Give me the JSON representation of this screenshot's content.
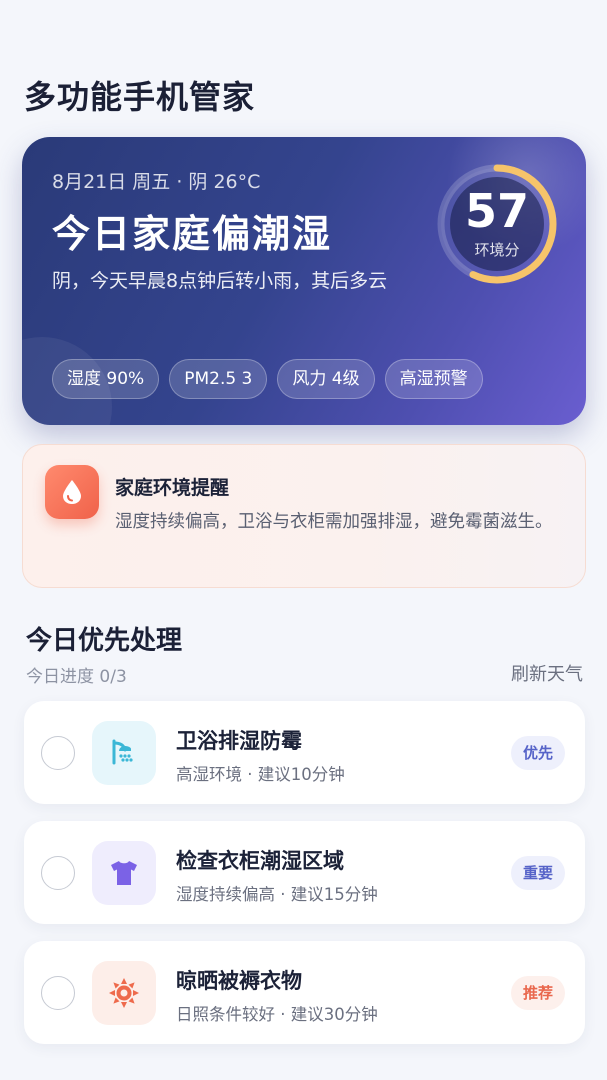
{
  "app": {
    "title": "多功能手机管家"
  },
  "hero": {
    "date": "8月21日 周五 · 阴 26°C",
    "headline": "今日家庭偏潮湿",
    "description": "阴，今天早晨8点钟后转小雨，其后多云",
    "score": {
      "value": "57",
      "label": "环境分",
      "progress": 0.57
    },
    "chips": [
      "湿度 90%",
      "PM2.5 3",
      "风力 4级",
      "高湿预警"
    ]
  },
  "reminder": {
    "icon": "water-drop-icon",
    "title": "家庭环境提醒",
    "text": "湿度持续偏高，卫浴与衣柜需加强排湿，避免霉菌滋生。"
  },
  "section": {
    "title": "今日优先处理",
    "progress": "今日进度 0/3",
    "refresh": "刷新天气"
  },
  "tasks": [
    {
      "name": "卫浴排湿防霉",
      "meta": "高湿环境 · 建议10分钟",
      "badge": "优先",
      "icon": "shower-icon",
      "checked": false
    },
    {
      "name": "检查衣柜潮湿区域",
      "meta": "湿度持续偏高 · 建议15分钟",
      "badge": "重要",
      "icon": "tshirt-icon",
      "checked": false
    },
    {
      "name": "晾晒被褥衣物",
      "meta": "日照条件较好 · 建议30分钟",
      "badge": "推荐",
      "icon": "sun-icon",
      "checked": false
    }
  ],
  "colors": {
    "accent": "#5663c8",
    "ring": "#f6c46a",
    "warning": "#f0624a"
  }
}
